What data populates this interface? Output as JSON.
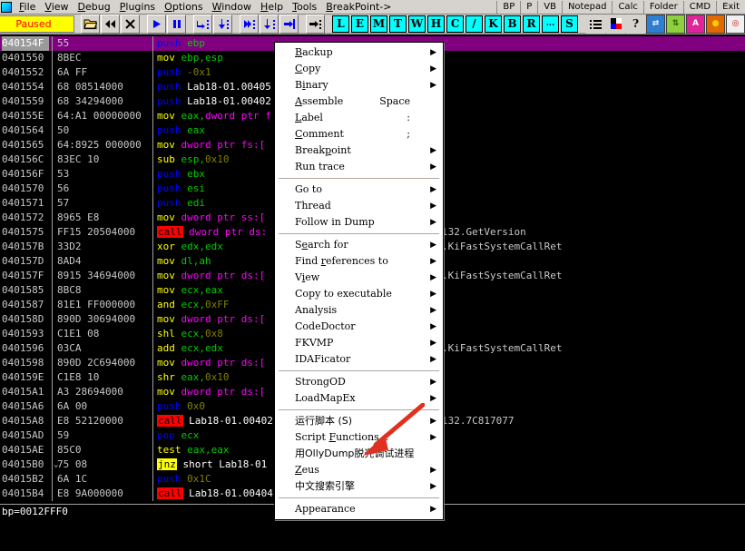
{
  "menubar": {
    "items": [
      "File",
      "View",
      "Debug",
      "Plugins",
      "Options",
      "Window",
      "Help",
      "Tools",
      "BreakPoint->"
    ],
    "right_buttons": [
      "BP",
      "P",
      "VB",
      "Notepad",
      "Calc",
      "Folder",
      "CMD",
      "Exit"
    ]
  },
  "toolbar": {
    "status_label": "Paused",
    "status_bg": "#ffff00",
    "status_fg": "#ff0000",
    "nav_icons": [
      "open-folder-icon",
      "restart-icon",
      "close-icon"
    ],
    "run_icons": [
      "run-icon",
      "pause-icon"
    ],
    "step_icons": [
      "step-into-icon",
      "step-over-icon",
      "trace-into-icon",
      "trace-over-icon",
      "execute-till-return-icon"
    ],
    "animate_icons": [
      "execute-till-cursor-icon"
    ],
    "letters": [
      "L",
      "E",
      "M",
      "T",
      "W",
      "H",
      "C",
      "/",
      "K",
      "B",
      "R",
      "...",
      "S"
    ],
    "extra_icons": [
      "options-list-icon",
      "appearance-icon",
      "help-icon"
    ],
    "plugin_icons": [
      "swap-icon",
      "updown-icon",
      "a-icon",
      "record-icon",
      "target-icon",
      "binary-icon",
      "window-icon",
      "red-icon"
    ],
    "accent_cyan": "#00ffff"
  },
  "disassembly": {
    "rows": [
      {
        "addr": "040154F",
        "hex": "55",
        "selected": true,
        "parts": [
          {
            "t": "push",
            "c": "mn-push"
          },
          {
            "t": " "
          },
          {
            "t": "ebp",
            "c": "reg"
          }
        ],
        "cmt": ""
      },
      {
        "addr": "0401550",
        "hex": "8BEC",
        "selected": false,
        "parts": [
          {
            "t": "mov",
            "c": "mn"
          },
          {
            "t": " "
          },
          {
            "t": "ebp,esp",
            "c": "reg"
          }
        ],
        "cmt": ""
      },
      {
        "addr": "0401552",
        "hex": "6A FF",
        "selected": false,
        "parts": [
          {
            "t": "push",
            "c": "mn-push"
          },
          {
            "t": " "
          },
          {
            "t": "-0x1",
            "c": "num"
          }
        ],
        "cmt": ""
      },
      {
        "addr": "0401554",
        "hex": "68 08514000",
        "selected": false,
        "parts": [
          {
            "t": "push",
            "c": "mn-push"
          },
          {
            "t": " "
          },
          {
            "t": "Lab18-01.00405",
            "c": "wh"
          }
        ],
        "cmt": ""
      },
      {
        "addr": "0401559",
        "hex": "68 34294000",
        "selected": false,
        "parts": [
          {
            "t": "push",
            "c": "mn-push"
          },
          {
            "t": " "
          },
          {
            "t": "Lab18-01.00402",
            "c": "wh"
          }
        ],
        "cmt": ""
      },
      {
        "addr": "040155E",
        "hex": "64:A1 00000000",
        "selected": false,
        "parts": [
          {
            "t": "mov",
            "c": "mn"
          },
          {
            "t": " "
          },
          {
            "t": "eax,",
            "c": "reg"
          },
          {
            "t": "dword ptr f",
            "c": "ptr"
          }
        ],
        "cmt": ""
      },
      {
        "addr": "0401564",
        "hex": "50",
        "selected": false,
        "parts": [
          {
            "t": "push",
            "c": "mn-push"
          },
          {
            "t": " "
          },
          {
            "t": "eax",
            "c": "reg"
          }
        ],
        "cmt": ""
      },
      {
        "addr": "0401565",
        "hex": "64:8925 000000",
        "selected": false,
        "parts": [
          {
            "t": "mov",
            "c": "mn"
          },
          {
            "t": " "
          },
          {
            "t": "dword ptr fs:[",
            "c": "ptr"
          }
        ],
        "cmt": ""
      },
      {
        "addr": "040156C",
        "hex": "83EC 10",
        "selected": false,
        "parts": [
          {
            "t": "sub",
            "c": "mn"
          },
          {
            "t": " "
          },
          {
            "t": "esp,",
            "c": "reg"
          },
          {
            "t": "0x10",
            "c": "num"
          }
        ],
        "cmt": ""
      },
      {
        "addr": "040156F",
        "hex": "53",
        "selected": false,
        "parts": [
          {
            "t": "push",
            "c": "mn-push"
          },
          {
            "t": " "
          },
          {
            "t": "ebx",
            "c": "reg"
          }
        ],
        "cmt": ""
      },
      {
        "addr": "0401570",
        "hex": "56",
        "selected": false,
        "parts": [
          {
            "t": "push",
            "c": "mn-push"
          },
          {
            "t": " "
          },
          {
            "t": "esi",
            "c": "reg"
          }
        ],
        "cmt": ""
      },
      {
        "addr": "0401571",
        "hex": "57",
        "selected": false,
        "parts": [
          {
            "t": "push",
            "c": "mn-push"
          },
          {
            "t": " "
          },
          {
            "t": "edi",
            "c": "reg"
          }
        ],
        "cmt": ""
      },
      {
        "addr": "0401572",
        "hex": "8965 E8",
        "selected": false,
        "parts": [
          {
            "t": "mov",
            "c": "mn"
          },
          {
            "t": " "
          },
          {
            "t": "dword ptr ss:[",
            "c": "ptr"
          }
        ],
        "cmt": ""
      },
      {
        "addr": "0401575",
        "hex": "FF15 20504000",
        "selected": false,
        "parts": [
          {
            "t": "call",
            "c": "mn-call"
          },
          {
            "t": " "
          },
          {
            "t": "dword ptr ds:",
            "c": "ptr"
          }
        ],
        "cmt": "l32.GetVersion"
      },
      {
        "addr": "040157B",
        "hex": "33D2",
        "selected": false,
        "parts": [
          {
            "t": "xor",
            "c": "mn"
          },
          {
            "t": " "
          },
          {
            "t": "edx,edx",
            "c": "reg"
          }
        ],
        "cmt": ".KiFastSystemCallRet"
      },
      {
        "addr": "040157D",
        "hex": "8AD4",
        "selected": false,
        "parts": [
          {
            "t": "mov",
            "c": "mn"
          },
          {
            "t": " "
          },
          {
            "t": "dl,ah",
            "c": "reg"
          }
        ],
        "cmt": ""
      },
      {
        "addr": "040157F",
        "hex": "8915 34694000",
        "selected": false,
        "parts": [
          {
            "t": "mov",
            "c": "mn"
          },
          {
            "t": " "
          },
          {
            "t": "dword ptr ds:[",
            "c": "ptr"
          }
        ],
        "cmt": ".KiFastSystemCallRet"
      },
      {
        "addr": "0401585",
        "hex": "8BC8",
        "selected": false,
        "parts": [
          {
            "t": "mov",
            "c": "mn"
          },
          {
            "t": " "
          },
          {
            "t": "ecx,eax",
            "c": "reg"
          }
        ],
        "cmt": ""
      },
      {
        "addr": "0401587",
        "hex": "81E1 FF000000",
        "selected": false,
        "parts": [
          {
            "t": "and",
            "c": "mn"
          },
          {
            "t": " "
          },
          {
            "t": "ecx,",
            "c": "reg"
          },
          {
            "t": "0xFF",
            "c": "num"
          }
        ],
        "cmt": ""
      },
      {
        "addr": "040158D",
        "hex": "890D 30694000",
        "selected": false,
        "parts": [
          {
            "t": "mov",
            "c": "mn"
          },
          {
            "t": " "
          },
          {
            "t": "dword ptr ds:[",
            "c": "ptr"
          }
        ],
        "cmt": ""
      },
      {
        "addr": "0401593",
        "hex": "C1E1 08",
        "selected": false,
        "parts": [
          {
            "t": "shl",
            "c": "mn"
          },
          {
            "t": " "
          },
          {
            "t": "ecx,",
            "c": "reg"
          },
          {
            "t": "0x8",
            "c": "num"
          }
        ],
        "cmt": ""
      },
      {
        "addr": "0401596",
        "hex": "03CA",
        "selected": false,
        "parts": [
          {
            "t": "add",
            "c": "mn"
          },
          {
            "t": " "
          },
          {
            "t": "ecx,edx",
            "c": "reg"
          }
        ],
        "cmt": ".KiFastSystemCallRet"
      },
      {
        "addr": "0401598",
        "hex": "890D 2C694000",
        "selected": false,
        "parts": [
          {
            "t": "mov",
            "c": "mn"
          },
          {
            "t": " "
          },
          {
            "t": "dword ptr ds:[",
            "c": "ptr"
          }
        ],
        "cmt": ""
      },
      {
        "addr": "040159E",
        "hex": "C1E8 10",
        "selected": false,
        "parts": [
          {
            "t": "shr",
            "c": "mn"
          },
          {
            "t": " "
          },
          {
            "t": "eax,",
            "c": "reg"
          },
          {
            "t": "0x10",
            "c": "num"
          }
        ],
        "cmt": ""
      },
      {
        "addr": "04015A1",
        "hex": "A3 28694000",
        "selected": false,
        "parts": [
          {
            "t": "mov",
            "c": "mn"
          },
          {
            "t": " "
          },
          {
            "t": "dword ptr ds:[",
            "c": "ptr"
          }
        ],
        "cmt": ""
      },
      {
        "addr": "04015A6",
        "hex": "6A 00",
        "selected": false,
        "parts": [
          {
            "t": "push",
            "c": "mn-push"
          },
          {
            "t": " "
          },
          {
            "t": "0x0",
            "c": "num"
          }
        ],
        "cmt": ""
      },
      {
        "addr": "04015A8",
        "hex": "E8 52120000",
        "selected": false,
        "parts": [
          {
            "t": "call",
            "c": "mn-call"
          },
          {
            "t": " "
          },
          {
            "t": "Lab18-01.00402",
            "c": "wh"
          }
        ],
        "cmt": "l32.7C817077"
      },
      {
        "addr": "04015AD",
        "hex": "59",
        "selected": false,
        "parts": [
          {
            "t": "pop",
            "c": "mn-push"
          },
          {
            "t": " "
          },
          {
            "t": "ecx",
            "c": "reg"
          }
        ],
        "cmt": ""
      },
      {
        "addr": "04015AE",
        "hex": "85C0",
        "selected": false,
        "parts": [
          {
            "t": "test",
            "c": "mn"
          },
          {
            "t": " "
          },
          {
            "t": "eax,eax",
            "c": "reg"
          }
        ],
        "cmt": ""
      },
      {
        "addr": "04015B0",
        "hex": "75 08",
        "selected": false,
        "jumparrow": true,
        "parts": [
          {
            "t": "jnz",
            "c": "mn-jmp"
          },
          {
            "t": " "
          },
          {
            "t": "short Lab18-01",
            "c": "wh"
          }
        ],
        "cmt": ""
      },
      {
        "addr": "04015B2",
        "hex": "6A 1C",
        "selected": false,
        "parts": [
          {
            "t": "push",
            "c": "mn-push"
          },
          {
            "t": " "
          },
          {
            "t": "0x1C",
            "c": "num"
          }
        ],
        "cmt": ""
      },
      {
        "addr": "04015B4",
        "hex": "E8 9A000000",
        "selected": false,
        "parts": [
          {
            "t": "call",
            "c": "mn-call"
          },
          {
            "t": " "
          },
          {
            "t": "Lab18-01.00404",
            "c": "wh"
          }
        ],
        "cmt": ""
      }
    ]
  },
  "statusbar": {
    "text": "bp=0012FFF0"
  },
  "context_menu": {
    "groups": [
      {
        "items": [
          {
            "label": "Backup",
            "accel_index": 0,
            "submenu": true,
            "shortcut": ""
          },
          {
            "label": "Copy",
            "accel_index": 0,
            "submenu": true,
            "shortcut": ""
          },
          {
            "label": "Binary",
            "accel_index": 1,
            "submenu": true,
            "shortcut": ""
          },
          {
            "label": "Assemble",
            "accel_index": 0,
            "submenu": false,
            "shortcut": "Space"
          },
          {
            "label": "Label",
            "accel_index": 0,
            "submenu": false,
            "shortcut": ":"
          },
          {
            "label": "Comment",
            "accel_index": 0,
            "submenu": false,
            "shortcut": ";"
          },
          {
            "label": "Breakpoint",
            "accel_index": 5,
            "submenu": true,
            "shortcut": ""
          },
          {
            "label": "Run trace",
            "accel_index": -1,
            "submenu": true,
            "shortcut": ""
          }
        ]
      },
      {
        "items": [
          {
            "label": "Go to",
            "accel_index": -1,
            "submenu": true,
            "shortcut": ""
          },
          {
            "label": "Thread",
            "accel_index": -1,
            "submenu": true,
            "shortcut": ""
          },
          {
            "label": "Follow in Dump",
            "accel_index": -1,
            "submenu": true,
            "shortcut": ""
          }
        ]
      },
      {
        "items": [
          {
            "label": "Search for",
            "accel_index": 1,
            "submenu": true,
            "shortcut": ""
          },
          {
            "label": "Find references to",
            "accel_index": 5,
            "submenu": true,
            "shortcut": ""
          },
          {
            "label": "View",
            "accel_index": 1,
            "submenu": true,
            "shortcut": ""
          },
          {
            "label": "Copy to executable",
            "accel_index": -1,
            "submenu": true,
            "shortcut": ""
          },
          {
            "label": "Analysis",
            "accel_index": -1,
            "submenu": true,
            "shortcut": ""
          },
          {
            "label": "CodeDoctor",
            "accel_index": -1,
            "submenu": true,
            "shortcut": ""
          },
          {
            "label": "FKVMP",
            "accel_index": -1,
            "submenu": true,
            "shortcut": ""
          },
          {
            "label": "IDAFicator",
            "accel_index": -1,
            "submenu": true,
            "shortcut": ""
          }
        ]
      },
      {
        "items": [
          {
            "label": "StrongOD",
            "accel_index": -1,
            "submenu": true,
            "shortcut": ""
          },
          {
            "label": "LoadMapEx",
            "accel_index": -1,
            "submenu": true,
            "shortcut": ""
          }
        ]
      },
      {
        "items": [
          {
            "label": "运行脚本 (S)",
            "accel_index": -1,
            "submenu": true,
            "shortcut": "",
            "cjk": true
          },
          {
            "label": "Script Functions...",
            "accel_index": 7,
            "submenu": true,
            "shortcut": ""
          },
          {
            "label": "用OllyDump脱壳调试进程",
            "accel_index": -1,
            "submenu": false,
            "shortcut": "",
            "cjk": true
          },
          {
            "label": "Zeus",
            "accel_index": 0,
            "submenu": true,
            "shortcut": ""
          },
          {
            "label": "中文搜索引擎",
            "accel_index": -1,
            "submenu": true,
            "shortcut": "",
            "cjk": true
          }
        ]
      },
      {
        "items": [
          {
            "label": "Appearance",
            "accel_index": -1,
            "submenu": true,
            "shortcut": ""
          }
        ]
      }
    ]
  },
  "annotation": {
    "arrow_color": "#e03020",
    "arrow_target": "用OllyDump脱壳调试进程"
  }
}
